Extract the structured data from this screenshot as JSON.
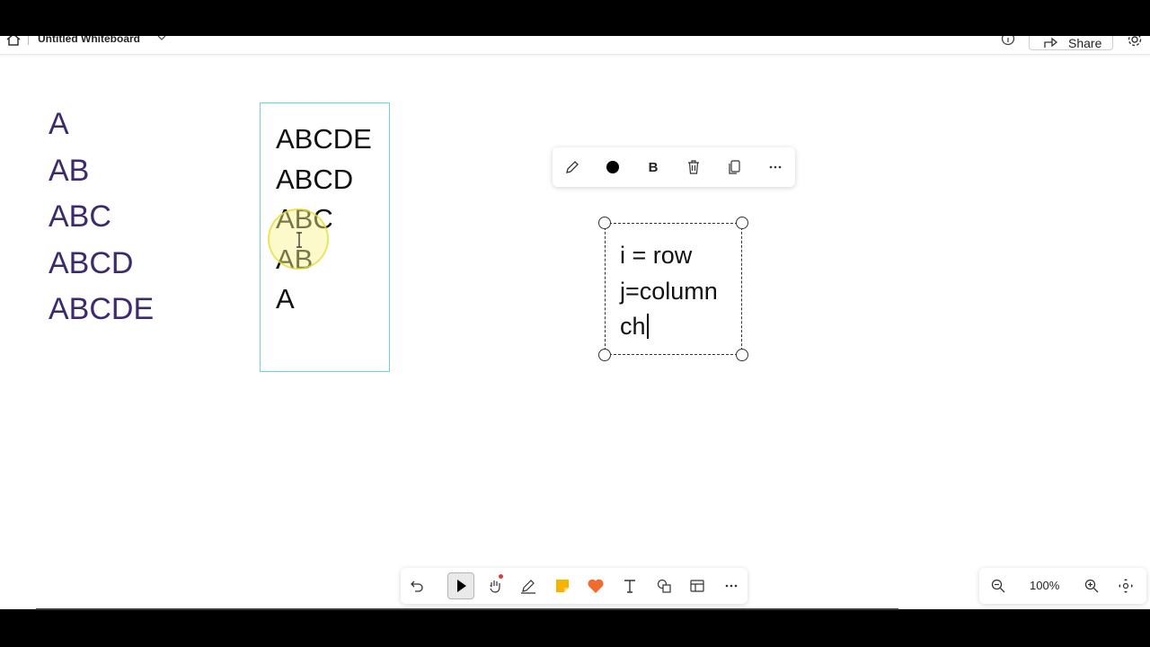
{
  "header": {
    "board_title": "Untitled Whiteboard",
    "share_label": "Share"
  },
  "canvas": {
    "left_pattern": [
      "A",
      "AB",
      "ABC",
      "ABCD",
      "ABCDE"
    ],
    "center_pattern": [
      "ABCDE",
      "ABCD",
      "ABC",
      "AB",
      "A"
    ],
    "text_box_lines": [
      "i = row",
      "j=column",
      "ch"
    ]
  },
  "text_toolbar": {
    "bold_label": "B",
    "icons": [
      "pencil-icon",
      "color-dot-icon",
      "bold-icon",
      "trash-icon",
      "copy-icon",
      "more-icon"
    ]
  },
  "tool_dock": {
    "icons": [
      "undo-icon",
      "select-pointer-icon",
      "hand-pan-icon",
      "pen-icon",
      "sticky-note-icon",
      "heart-reaction-icon",
      "text-tool-icon",
      "shapes-icon",
      "template-icon",
      "more-icon"
    ],
    "active_tool": "select-pointer-icon"
  },
  "zoom": {
    "level": "100%"
  },
  "colors": {
    "left_text": "#3d2a6e",
    "center_box_border": "#6fd4dc",
    "sticky_note": "#f8b200",
    "heart": "#f26a2e",
    "record_dot": "#e53935"
  }
}
